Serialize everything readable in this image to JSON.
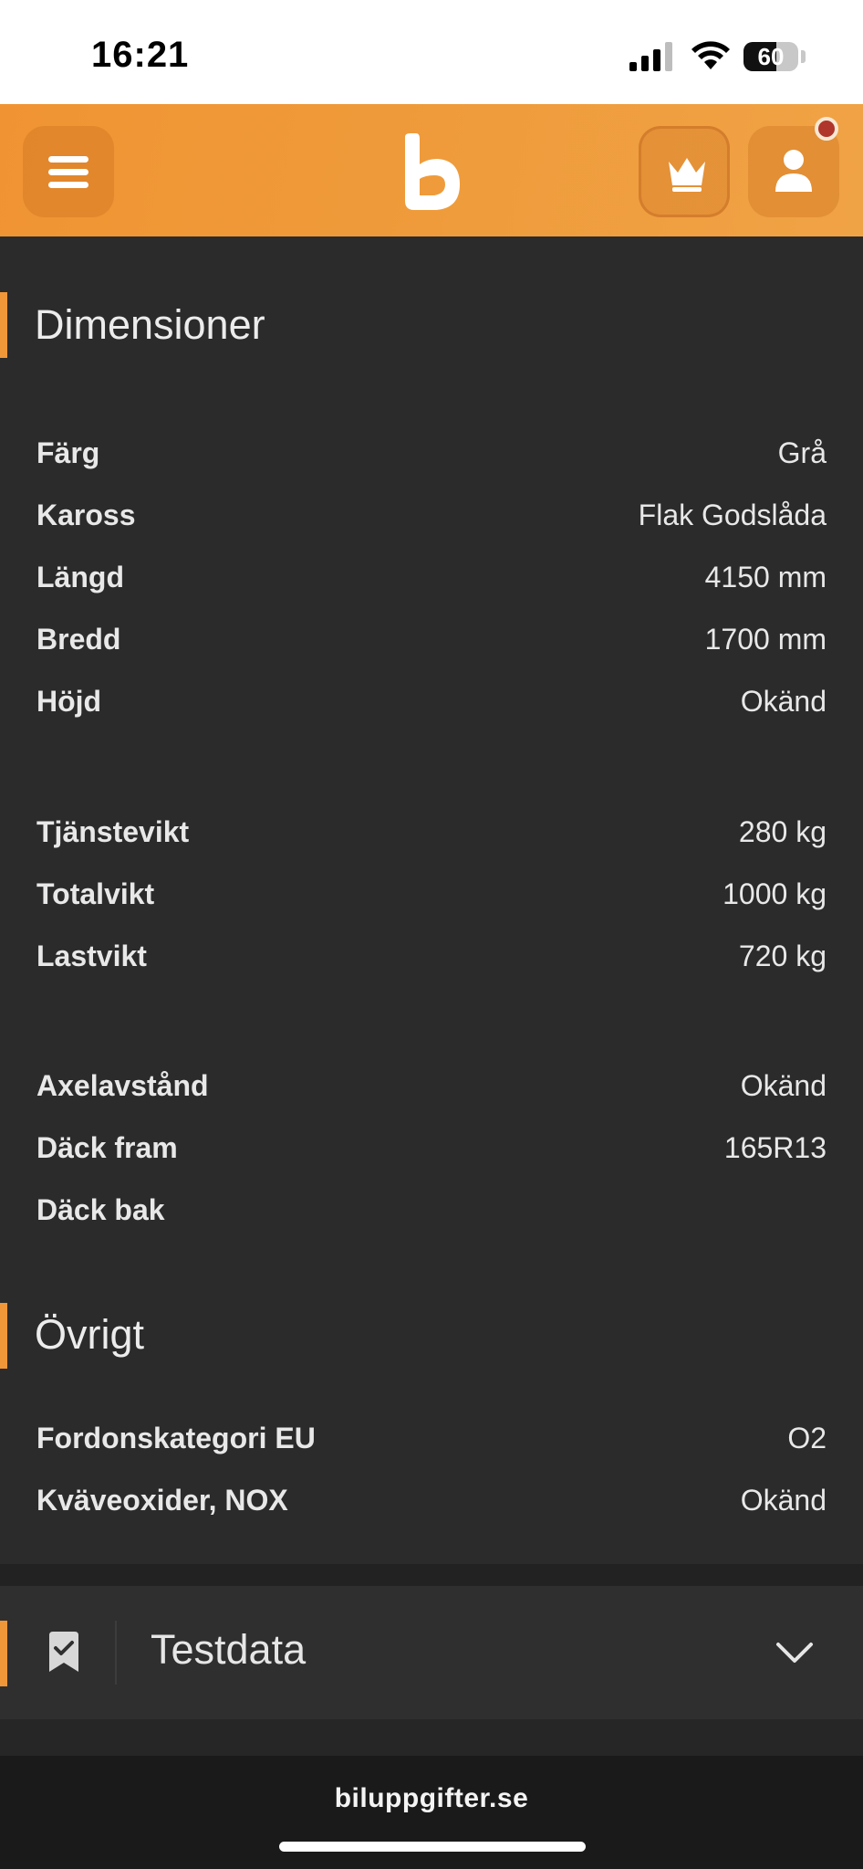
{
  "status_bar": {
    "time": "16:21",
    "battery": "60",
    "battery_level": 0.6
  },
  "header": {
    "menu_icon": "hamburger-menu-icon",
    "logo_letter": "b",
    "premium_icon": "crown-icon",
    "profile_icon": "user-icon",
    "notification": true,
    "brand_color": "#f09433"
  },
  "dimensions": {
    "title": "Dimensioner",
    "rows": [
      {
        "label": "Färg",
        "value": "Grå"
      },
      {
        "label": "Kaross",
        "value": "Flak Godslåda"
      },
      {
        "label": "Längd",
        "value": "4150 mm"
      },
      {
        "label": "Bredd",
        "value": "1700 mm"
      },
      {
        "label": "Höjd",
        "value": "Okänd"
      },
      {
        "label": "Tjänstevikt",
        "value": "280 kg"
      },
      {
        "label": "Totalvikt",
        "value": "1000 kg"
      },
      {
        "label": "Lastvikt",
        "value": "720 kg"
      },
      {
        "label": "Axelavstånd",
        "value": "Okänd"
      },
      {
        "label": "Däck fram",
        "value": "165R13"
      },
      {
        "label": "Däck bak",
        "value": ""
      }
    ]
  },
  "other": {
    "title": "Övrigt",
    "rows": [
      {
        "label": "Fordonskategori EU",
        "value": "O2"
      },
      {
        "label": "Kväveoxider, NOX",
        "value": "Okänd"
      }
    ]
  },
  "testdata": {
    "title": "Testdata",
    "icon": "bookmark-check-icon",
    "toggle_icon": "chevron-down-icon"
  },
  "browser": {
    "url": "biluppgifter.se"
  }
}
